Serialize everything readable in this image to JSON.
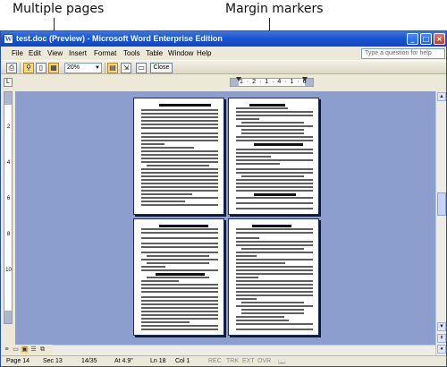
{
  "callouts": {
    "multiple_pages": "Multiple pages",
    "margin_markers": "Margin markers"
  },
  "window": {
    "title": "test.doc (Preview) - Microsoft Word Enterprise Edition",
    "minimize": "_",
    "maximize": "□",
    "close": "×"
  },
  "menu": {
    "items": [
      "File",
      "Edit",
      "View",
      "Insert",
      "Format",
      "Tools",
      "Table",
      "Window",
      "Help"
    ],
    "help_placeholder": "Type a question for help"
  },
  "toolbar": {
    "zoom_value": "20%",
    "close_label": "Close",
    "icons": [
      "print-icon",
      "magnifier-icon",
      "one-page-icon",
      "multiple-pages-icon",
      "view-ruler-icon",
      "shrink-to-fit-icon",
      "full-screen-icon"
    ]
  },
  "ruler": {
    "numbers": "1 · 2 · 1 · 4 · 1 · 6",
    "v_ticks": [
      "2",
      "4",
      "6",
      "8",
      "10"
    ]
  },
  "status": {
    "page": "Page 14",
    "section": "Sec 13",
    "page_count": "14/35",
    "at": "At 4.9\"",
    "line": "Ln 18",
    "col": "Col 1",
    "rec": "REC",
    "trk": "TRK",
    "ext": "EXT",
    "ovr": "OVR"
  }
}
